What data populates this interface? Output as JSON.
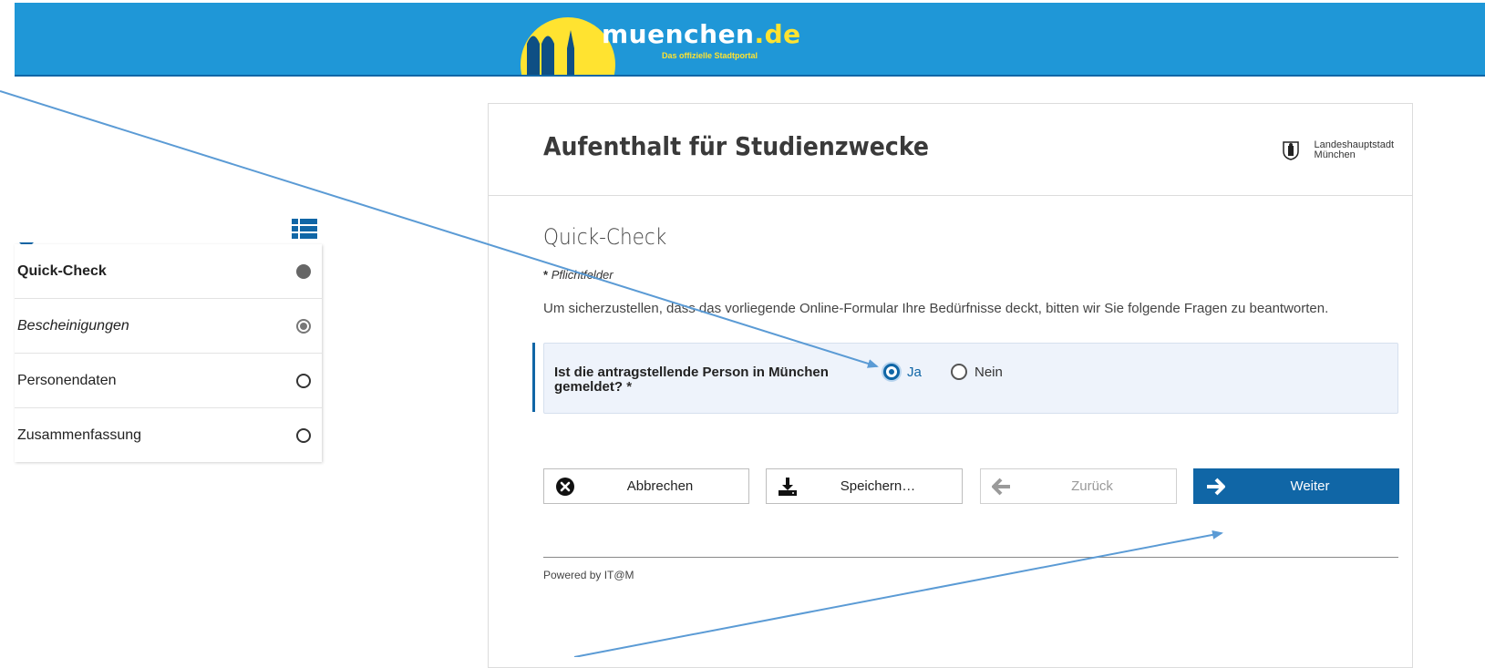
{
  "header": {
    "logo_text_main": "muenchen",
    "logo_text_dot": ".de",
    "logo_tagline": "Das offizielle Stadtportal",
    "brand_color": "#1f97d7"
  },
  "sidebar": {
    "toggle_icon": "list-icon",
    "items": [
      {
        "label": "Quick-Check",
        "status": "current"
      },
      {
        "label": "Bescheinigungen",
        "status": "partial"
      },
      {
        "label": "Personendaten",
        "status": "open"
      },
      {
        "label": "Zusammenfassung",
        "status": "open"
      }
    ]
  },
  "form": {
    "title": "Aufenthalt für Studienzwecke",
    "city_line1": "Landeshauptstadt",
    "city_line2": "München",
    "section_title": "Quick-Check",
    "required_star": "*",
    "required_note": "Pflichtfelder",
    "intro": "Um sicherzustellen, dass das vorliegende Online-Formular Ihre Bedürfnisse deckt, bitten wir Sie folgende Fragen zu beantworten.",
    "question": {
      "label": "Ist die antragstellende Person in München gemeldet?",
      "star": "*",
      "options": [
        {
          "label": "Ja",
          "selected": true
        },
        {
          "label": "Nein",
          "selected": false
        }
      ]
    },
    "buttons": {
      "cancel": "Abbrechen",
      "save": "Speichern…",
      "back": "Zurück",
      "next": "Weiter"
    },
    "footer": "Powered by IT@M"
  },
  "colors": {
    "primary": "#1066a6",
    "question_bg": "#eef3fb",
    "annotation_arrow": "#5b9bd5"
  }
}
